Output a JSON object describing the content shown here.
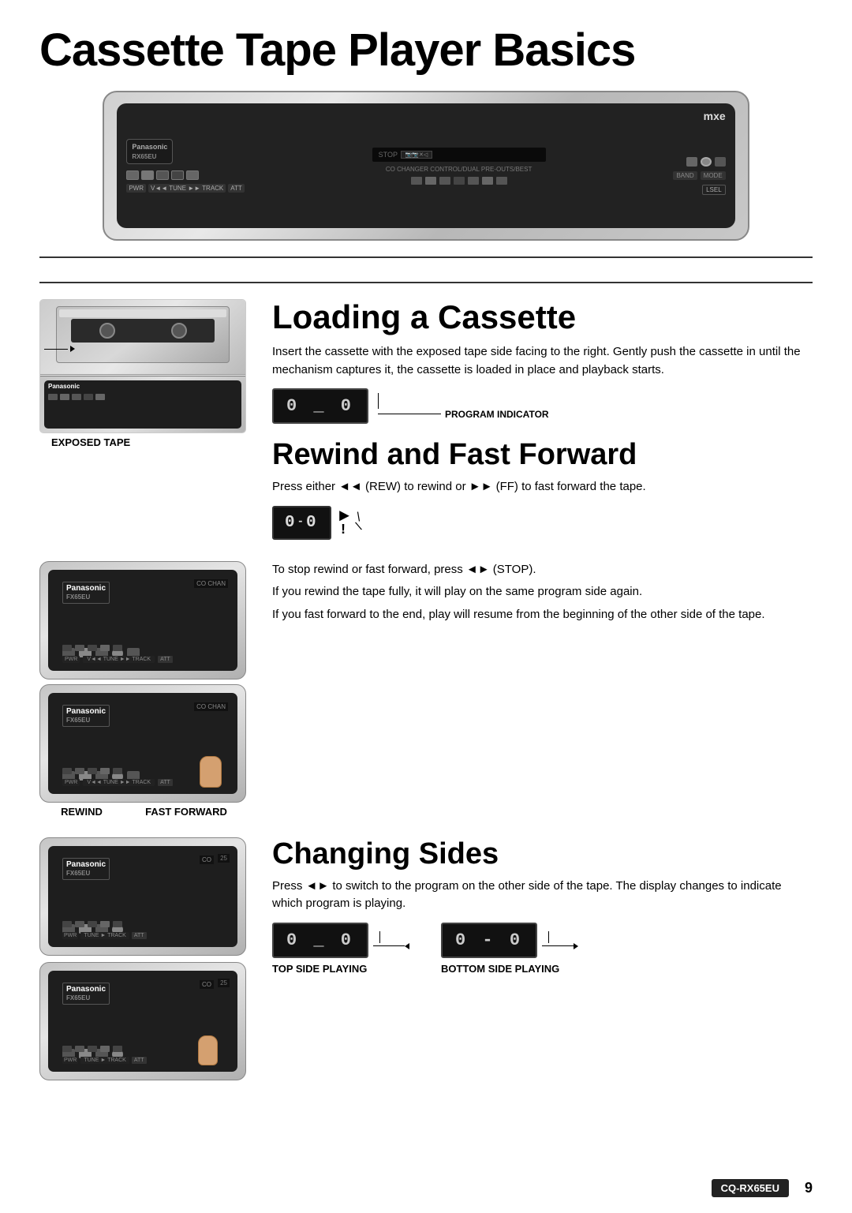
{
  "page": {
    "title": "Cassette Tape Player Basics",
    "page_number": "9",
    "model": "CQ-RX65EU"
  },
  "loading_section": {
    "heading": "Loading a Cassette",
    "body": "Insert the cassette with the exposed tape side facing to the right. Gently push the cassette in until the mechanism captures it, the cassette is loaded in place and playback starts.",
    "exposed_tape_label": "EXPOSED TAPE",
    "program_indicator_label": "PROGRAM INDICATOR",
    "display_value": "0 _ 0",
    "display_value2": "0 - 0"
  },
  "rewind_section": {
    "heading": "Rewind and Fast Forward",
    "body": "Press either ◄◄ (REW) to rewind or ►► (FF) to fast forward the tape.",
    "rewind_label": "REWIND",
    "fast_forward_label": "FAST FORWARD",
    "display_value": "0-0 ►!",
    "stop_text": "To stop rewind or fast forward, press ◄► (STOP).",
    "rewind_full_text": "If you rewind the tape fully, it will play on the same program side again.",
    "fast_forward_end_text": "If you fast forward to the end, play will resume from the beginning of the other side of the tape."
  },
  "changing_sides_section": {
    "heading": "Changing Sides",
    "body": "Press ◄► to switch to the program on the other side of the tape. The display changes to indicate which program is playing.",
    "top_side_label": "TOP SIDE PLAYING",
    "bottom_side_label": "BOTTOM SIDE PLAYING",
    "top_display": "0 _ 0",
    "bottom_display": "0 - 0"
  }
}
